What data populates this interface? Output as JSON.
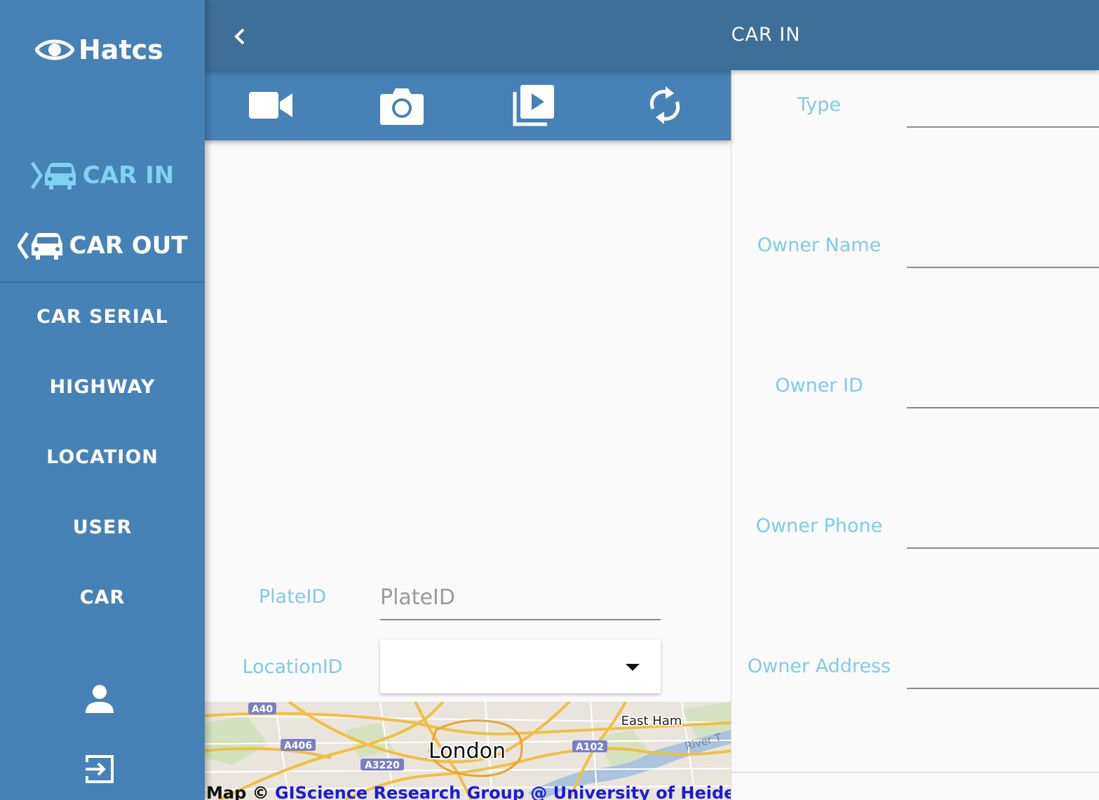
{
  "app": {
    "name": "Hatcs"
  },
  "header": {
    "title": "CAR IN",
    "back_icon": "chevron-left-icon"
  },
  "sidebar": {
    "primary": [
      {
        "label": "CAR IN",
        "icon": "car-in-icon",
        "active": true
      },
      {
        "label": "CAR OUT",
        "icon": "car-out-icon",
        "active": false
      }
    ],
    "secondary": [
      {
        "label": "CAR SERIAL"
      },
      {
        "label": "HIGHWAY"
      },
      {
        "label": "LOCATION"
      },
      {
        "label": "USER"
      },
      {
        "label": "CAR"
      }
    ],
    "bottom_icons": [
      "person-icon",
      "logout-icon"
    ]
  },
  "toolbar": {
    "icons": [
      "video-camera-icon",
      "camera-icon",
      "play-library-icon",
      "refresh-icon"
    ]
  },
  "form": {
    "plate": {
      "label": "PlateID",
      "placeholder": "PlateID",
      "value": ""
    },
    "location": {
      "label": "LocationID",
      "value": ""
    }
  },
  "map": {
    "labels": {
      "a40": "A40",
      "a406": "A406",
      "a3220": "A3220",
      "a102": "A102",
      "london": "London",
      "east_ham": "East Ham",
      "river": "River T"
    },
    "attribution_prefix": "Map © ",
    "attribution_link": "GIScience Research Group @ University of Heidelberg"
  },
  "details": {
    "type_label": "Type",
    "owner_name_label": "Owner Name",
    "owner_id_label": "Owner ID",
    "owner_phone_label": "Owner Phone",
    "owner_address_label": "Owner Address"
  },
  "colors": {
    "sidebar": "#4682b6",
    "topbar": "#3e6f98",
    "accent": "#7fd3f0",
    "label": "#7fcbea"
  }
}
